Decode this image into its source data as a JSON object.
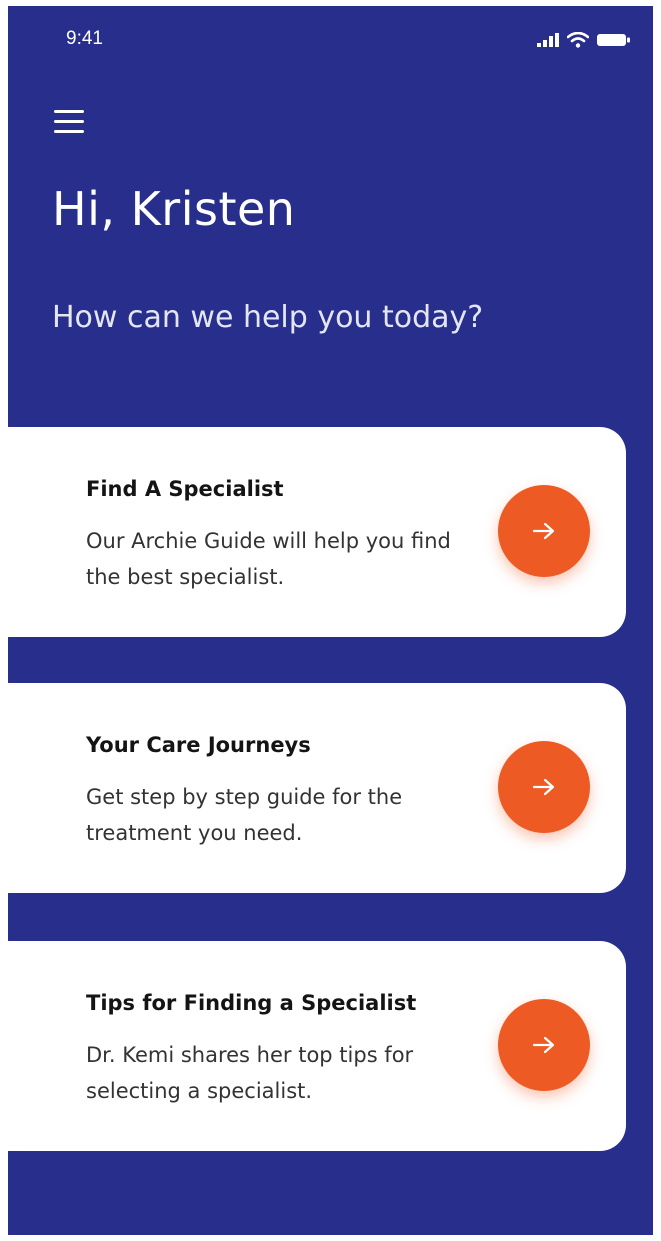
{
  "status_bar": {
    "time": "9:41"
  },
  "header": {
    "greeting": "Hi, Kristen",
    "subtitle": "How can we help you today?"
  },
  "cards": [
    {
      "title": "Find A Specialist",
      "description": "Our Archie Guide will help you find the best specialist."
    },
    {
      "title": "Your Care Journeys",
      "description": "Get step by step guide for the treatment you need."
    },
    {
      "title": "Tips for Finding a Specialist",
      "description": "Dr. Kemi shares her top tips for selecting a specialist."
    }
  ],
  "icons": {
    "menu": "menu-icon",
    "card_action": "arrow-right-icon",
    "signal": "signal-icon",
    "wifi": "wifi-icon",
    "battery": "battery-icon"
  },
  "colors": {
    "background": "#282e8c",
    "accent": "#ee5a23",
    "card": "#ffffff"
  }
}
